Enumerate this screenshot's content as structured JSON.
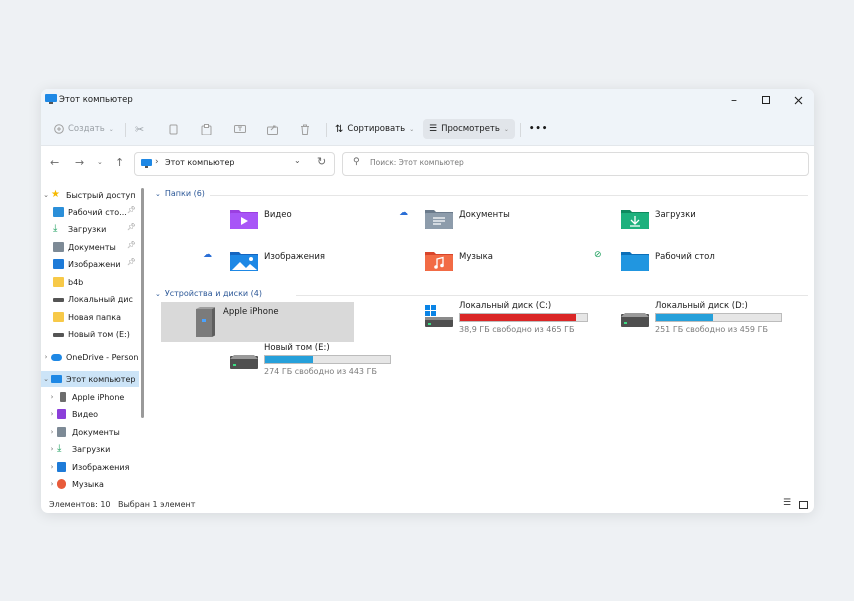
{
  "window": {
    "title": "Этот компьютер"
  },
  "toolbar": {
    "create": "Создать",
    "sort": "Сортировать",
    "view": "Просмотреть",
    "more": "•••"
  },
  "address": {
    "path": "Этот компьютер",
    "search_placeholder": "Поиск: Этот компьютер"
  },
  "sidebar": {
    "quick_access": "Быстрый доступ",
    "quick_items": [
      "Рабочий сто...",
      "Загрузки",
      "Документы",
      "Изображени",
      "b4b",
      "Локальный дис",
      "Новая папка",
      "Новый том (E:)"
    ],
    "onedrive": "OneDrive - Person",
    "this_pc": "Этот компьютер",
    "pc_items": [
      "Apple iPhone",
      "Видео",
      "Документы",
      "Загрузки",
      "Изображения",
      "Музыка"
    ]
  },
  "folders_section": {
    "title": "Папки (6)"
  },
  "folders": [
    "Видео",
    "Документы",
    "Загрузки",
    "Изображения",
    "Музыка",
    "Рабочий стол"
  ],
  "drives_section": {
    "title": "Устройства и диски (4)"
  },
  "devices": {
    "iphone": "Apple iPhone",
    "c": {
      "name": "Локальный диск (C:)",
      "free": "38,9 ГБ свободно из 465 ГБ",
      "used_fraction": 0.916
    },
    "d": {
      "name": "Локальный диск (D:)",
      "free": "251 ГБ свободно из 459 ГБ",
      "used_fraction": 0.453
    },
    "e": {
      "name": "Новый том (E:)",
      "free": "274 ГБ свободно из 443 ГБ",
      "used_fraction": 0.381
    }
  },
  "status": {
    "count": "Элементов: 10",
    "selected": "Выбран 1 элемент"
  },
  "colors": {
    "accent": "#0078d4",
    "drive_bar": "#26a0da",
    "drive_full": "#da2626"
  }
}
